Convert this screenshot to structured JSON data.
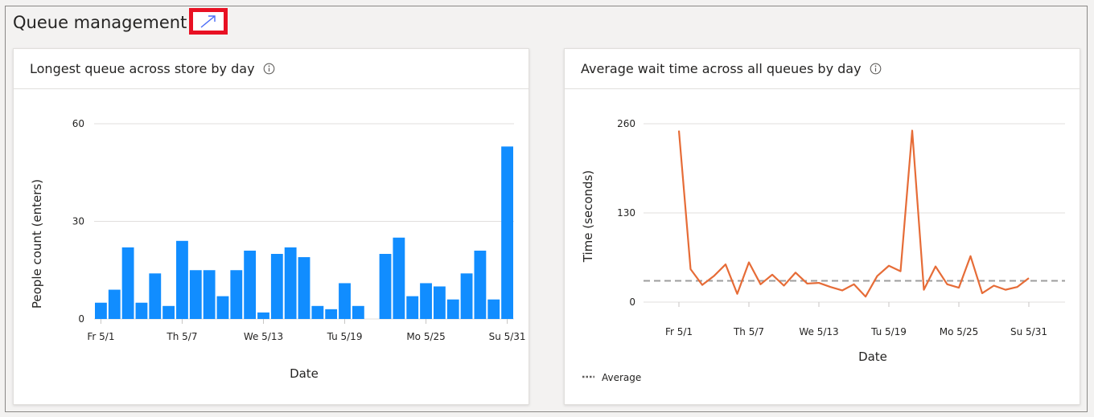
{
  "page": {
    "title": "Queue management"
  },
  "cards": [
    {
      "title": "Longest queue across store by day",
      "info_icon": "info-icon"
    },
    {
      "title": "Average wait time across all queues by day",
      "info_icon": "info-icon"
    }
  ],
  "icons": {
    "expand": "diagonal-arrow-icon",
    "info": "info-circle-icon"
  },
  "colors": {
    "bar": "#118dff",
    "line": "#e66c37",
    "average": "#9e9e9e",
    "highlight": "#e81123"
  },
  "chart_data": [
    {
      "type": "bar",
      "xlabel": "Date",
      "ylabel": "People count (enters)",
      "ylim": [
        0,
        60
      ],
      "yticks": [
        0,
        30,
        60
      ],
      "xticks": [
        "Fr 5/1",
        "Th 5/7",
        "We 5/13",
        "Tu 5/19",
        "Mo 5/25",
        "Su 5/31"
      ],
      "xtick_index": [
        0,
        6,
        12,
        18,
        24,
        30
      ],
      "values": [
        5,
        9,
        22,
        5,
        14,
        4,
        24,
        15,
        15,
        7,
        15,
        21,
        2,
        20,
        22,
        19,
        4,
        3,
        11,
        4,
        null,
        20,
        25,
        7,
        11,
        10,
        6,
        14,
        21,
        6,
        53
      ],
      "grid": true
    },
    {
      "type": "line",
      "xlabel": "Date",
      "ylabel": "Time (seconds)",
      "ylim": [
        0,
        260
      ],
      "yticks": [
        0,
        130,
        260
      ],
      "xticks": [
        "Fr 5/1",
        "Th 5/7",
        "We 5/13",
        "Tu 5/19",
        "Mo 5/25",
        "Su 5/31"
      ],
      "xtick_index": [
        0,
        6,
        12,
        18,
        24,
        30
      ],
      "values": [
        250,
        48,
        25,
        38,
        55,
        12,
        58,
        26,
        40,
        24,
        43,
        27,
        28,
        22,
        17,
        26,
        8,
        38,
        53,
        45,
        250,
        18,
        52,
        26,
        21,
        67,
        13,
        24,
        18,
        22,
        35
      ],
      "average": 31,
      "legend": [
        {
          "name": "Average",
          "style": "dashed"
        }
      ],
      "legend_position": "bottom-left",
      "grid": true
    }
  ]
}
